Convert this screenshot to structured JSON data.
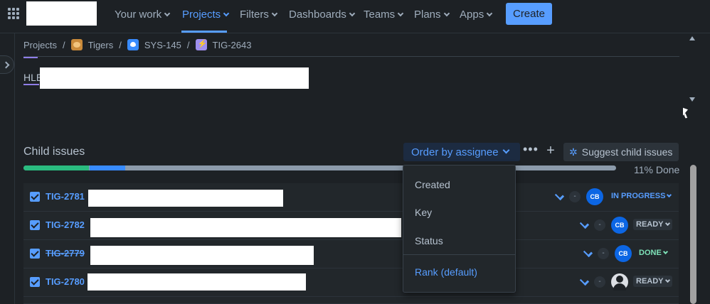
{
  "nav": {
    "items": [
      {
        "label": "Your work",
        "active": false
      },
      {
        "label": "Projects",
        "active": true
      },
      {
        "label": "Filters",
        "active": false
      },
      {
        "label": "Dashboards",
        "active": false
      },
      {
        "label": "Teams",
        "active": false
      },
      {
        "label": "Plans",
        "active": false
      },
      {
        "label": "Apps",
        "active": false
      }
    ],
    "create_label": "Create",
    "accent_color": "#579dff"
  },
  "breadcrumb": {
    "items": [
      {
        "label": "Projects",
        "icon": null
      },
      {
        "label": "Tigers",
        "icon": "tiger-project-icon"
      },
      {
        "label": "SYS-145",
        "icon": "epic-icon"
      },
      {
        "label": "TIG-2643",
        "icon": "task-icon"
      }
    ],
    "separator": "/"
  },
  "description": {
    "hle_prefix": "HLE"
  },
  "child_issues": {
    "title": "Child issues",
    "order_label": "Order by assignee",
    "more_label": "•••",
    "add_label": "+",
    "suggest_label": "Suggest child issues",
    "done_label": "11% Done",
    "progress": {
      "done_fraction": 0.11,
      "in_progress_fraction": 0.06,
      "todo_fraction": 0.83
    },
    "rows": [
      {
        "key": "TIG-2781",
        "done": false,
        "priority": "low",
        "estimate": "-",
        "assignee": "CB",
        "status": "IN PROGRESS"
      },
      {
        "key": "TIG-2782",
        "done": false,
        "priority": "low",
        "estimate": "-",
        "assignee": "CB",
        "status": "READY"
      },
      {
        "key": "TIG-2779",
        "done": true,
        "priority": "low",
        "estimate": "-",
        "assignee": "CB",
        "status": "DONE"
      },
      {
        "key": "TIG-2780",
        "done": false,
        "priority": "low",
        "estimate": "-",
        "assignee": "",
        "status": "READY"
      }
    ]
  },
  "order_menu": {
    "options": [
      {
        "label": "Created",
        "selected": false
      },
      {
        "label": "Key",
        "selected": false
      },
      {
        "label": "Status",
        "selected": false
      },
      {
        "label": "Rank (default)",
        "selected": true
      }
    ]
  }
}
